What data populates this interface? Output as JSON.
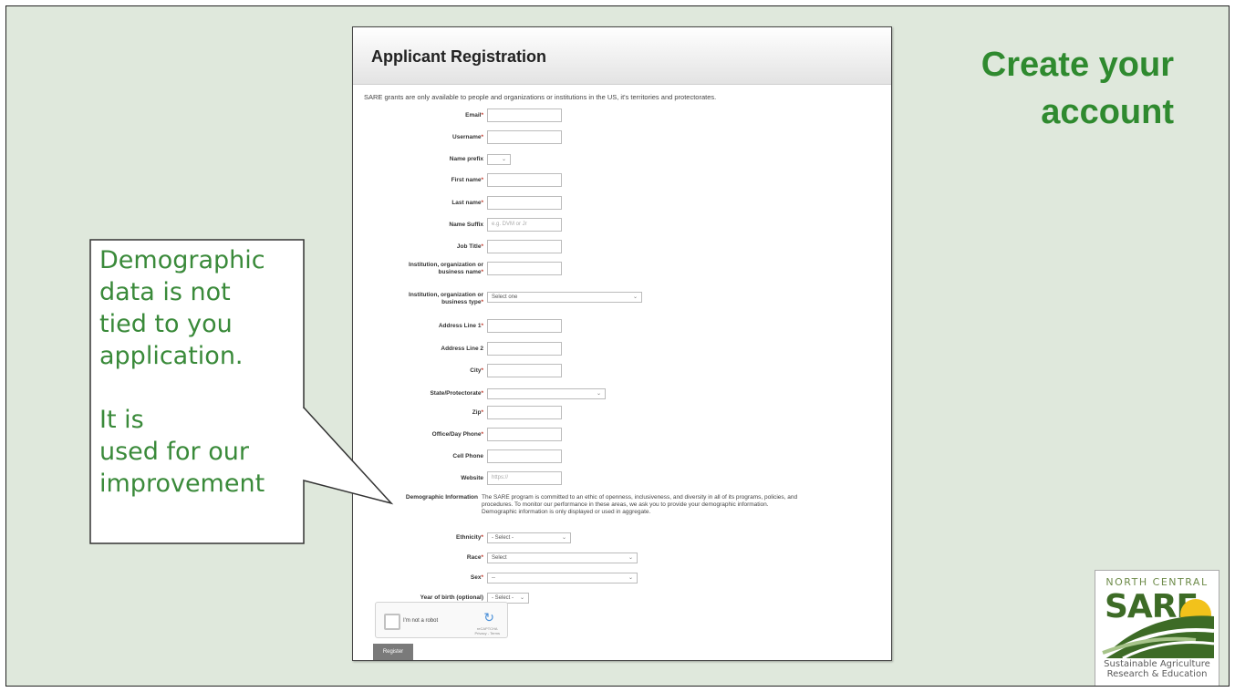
{
  "slide": {
    "heading_line1": "Create your",
    "heading_line2": "account"
  },
  "form": {
    "title": "Applicant Registration",
    "intro": "SARE grants are only available to people and organizations or institutions in the US, it's territories and protectorates.",
    "required_mark": "*",
    "fields": {
      "email": {
        "label": "Email"
      },
      "username": {
        "label": "Username"
      },
      "name_prefix": {
        "label": "Name prefix",
        "value": ""
      },
      "first_name": {
        "label": "First name"
      },
      "last_name": {
        "label": "Last name"
      },
      "name_suffix": {
        "label": "Name Suffix",
        "placeholder": "e.g. DVM or Jr"
      },
      "job_title": {
        "label": "Job Title"
      },
      "institution_name": {
        "label_1": "Institution, organization or",
        "label_2": "business name"
      },
      "institution_type": {
        "label_1": "Institution, organization or",
        "label_2": "business type",
        "value": "Select one"
      },
      "address1": {
        "label": "Address Line 1"
      },
      "address2": {
        "label": "Address Line 2"
      },
      "city": {
        "label": "City"
      },
      "state": {
        "label": "State/Protectorate",
        "value": ""
      },
      "zip": {
        "label": "Zip"
      },
      "office_phone": {
        "label": "Office/Day Phone"
      },
      "cell_phone": {
        "label": "Cell Phone"
      },
      "website": {
        "label": "Website",
        "placeholder": "https://"
      }
    },
    "demographic": {
      "label": "Demographic Information",
      "text_1": "The SARE program is committed to an ethic of openness, inclusiveness, and diversity in all of its programs, policies, and",
      "text_2": "procedures. To monitor our performance in these areas, we ask you to provide your demographic information.",
      "text_3": "Demographic information is only displayed or used in aggregate.",
      "ethnicity": {
        "label": "Ethnicity",
        "value": "- Select -"
      },
      "race": {
        "label": "Race",
        "value": "Select"
      },
      "sex": {
        "label": "Sex",
        "value": "--"
      },
      "year_of_birth": {
        "label": "Year of birth (optional)",
        "value": "- Select -"
      }
    },
    "captcha": {
      "label": "I'm not a robot",
      "sub_1": "reCAPTCHA",
      "sub_2": "Privacy - Terms"
    },
    "register_label": "Register"
  },
  "callout": {
    "text": "Demographic\ndata is not\ntied to you\napplication.\n\nIt is\nused for our\nimprovement"
  },
  "logo": {
    "top": "NORTH CENTRAL",
    "name": "SARE",
    "sub_1": "Sustainable Agriculture",
    "sub_2": "Research & Education"
  },
  "colors": {
    "slide_bg": "#dfe8dc",
    "accent_green": "#2f8a2f",
    "callout_green": "#3a8a3a",
    "required_red": "#c0392b"
  }
}
